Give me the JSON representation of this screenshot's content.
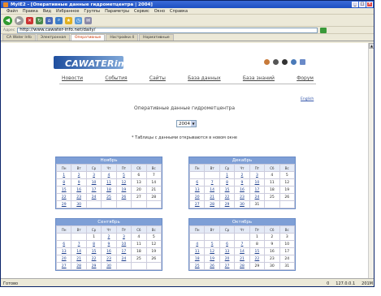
{
  "window": {
    "title": "MyIE2 - [Оперативные данные гидрометцентра | 2004]",
    "buttons": [
      "_",
      "□",
      "×"
    ]
  },
  "menu": [
    "Файл",
    "Правка",
    "Вид",
    "Избранное",
    "Группы",
    "Параметры",
    "Сервис",
    "Окно",
    "Справка"
  ],
  "address": {
    "label": "Адрес",
    "url": "http://www.cawater-info.net/daily/"
  },
  "tabs": [
    "CA Water Info",
    "Электронная",
    "Оперативные",
    "Настройки 4",
    "Нормативные"
  ],
  "site": {
    "logo": "CAWATERinfo",
    "nav": [
      "Новости",
      "События",
      "Сайты",
      "База данных",
      "База знаний",
      "Форум"
    ],
    "lang": "English",
    "heading": "Оперативные данные гидрометцентра",
    "year": "2004",
    "note": "* Таблицы с данными открываются в новом окне"
  },
  "calendars": [
    {
      "month": "Ноябрь",
      "days": [
        "Пн",
        "Вт",
        "Ср",
        "Чт",
        "Пт",
        "Сб",
        "Вс"
      ],
      "weeks": [
        [
          "1",
          "2",
          "3",
          "4",
          "5",
          "6",
          "7"
        ],
        [
          "8",
          "9",
          "10",
          "11",
          "12",
          "13",
          "14"
        ],
        [
          "15",
          "16",
          "17",
          "18",
          "19",
          "20",
          "21"
        ],
        [
          "22",
          "23",
          "24",
          "25",
          "26",
          "27",
          "28"
        ],
        [
          "29",
          "30",
          "",
          "",
          "",
          "",
          ""
        ]
      ],
      "linked": [
        "1",
        "2",
        "3",
        "4",
        "5",
        "8",
        "9",
        "10",
        "11",
        "12",
        "15",
        "16",
        "17",
        "18",
        "19",
        "22",
        "23",
        "24",
        "25",
        "26",
        "29",
        "30"
      ]
    },
    {
      "month": "Декабрь",
      "days": [
        "Пн",
        "Вт",
        "Ср",
        "Чт",
        "Пт",
        "Сб",
        "Вс"
      ],
      "weeks": [
        [
          "",
          "",
          "1",
          "2",
          "3",
          "4",
          "5"
        ],
        [
          "6",
          "7",
          "8",
          "9",
          "10",
          "11",
          "12"
        ],
        [
          "13",
          "14",
          "15",
          "16",
          "17",
          "18",
          "19"
        ],
        [
          "20",
          "21",
          "22",
          "23",
          "24",
          "25",
          "26"
        ],
        [
          "27",
          "28",
          "29",
          "30",
          "31",
          "",
          ""
        ]
      ],
      "linked": [
        "1",
        "2",
        "3",
        "6",
        "7",
        "8",
        "9",
        "10",
        "13",
        "14",
        "15",
        "16",
        "17",
        "20",
        "21",
        "22",
        "23",
        "24",
        "27",
        "28",
        "29",
        "30"
      ]
    },
    {
      "month": "Сентябрь",
      "days": [
        "Пн",
        "Вт",
        "Ср",
        "Чт",
        "Пт",
        "Сб",
        "Вс"
      ],
      "weeks": [
        [
          "",
          "",
          "1",
          "2",
          "3",
          "4",
          "5"
        ],
        [
          "6",
          "7",
          "8",
          "9",
          "10",
          "11",
          "12"
        ],
        [
          "13",
          "14",
          "15",
          "16",
          "17",
          "18",
          "19"
        ],
        [
          "20",
          "21",
          "22",
          "23",
          "24",
          "25",
          "26"
        ],
        [
          "27",
          "28",
          "29",
          "30",
          "",
          "",
          ""
        ]
      ],
      "linked": [
        "2",
        "3",
        "6",
        "7",
        "8",
        "9",
        "10",
        "13",
        "14",
        "15",
        "16",
        "17",
        "20",
        "21",
        "22",
        "23",
        "24",
        "27",
        "28",
        "29",
        "30"
      ]
    },
    {
      "month": "Октябрь",
      "days": [
        "Пн",
        "Вт",
        "Ср",
        "Чт",
        "Пт",
        "Сб",
        "Вс"
      ],
      "weeks": [
        [
          "",
          "",
          "",
          "",
          "1",
          "2",
          "3"
        ],
        [
          "4",
          "5",
          "6",
          "7",
          "8",
          "9",
          "10"
        ],
        [
          "11",
          "12",
          "13",
          "14",
          "15",
          "16",
          "17"
        ],
        [
          "18",
          "19",
          "20",
          "21",
          "22",
          "23",
          "24"
        ],
        [
          "25",
          "26",
          "27",
          "28",
          "29",
          "30",
          "31"
        ]
      ],
      "linked": [
        "4",
        "5",
        "6",
        "7",
        "11",
        "12",
        "13",
        "14",
        "15",
        "18",
        "19",
        "20",
        "21",
        "22",
        "25",
        "26",
        "27",
        "28"
      ]
    }
  ],
  "status": {
    "text": "Готово",
    "count": "0",
    "ip": "127.0.0.1",
    "mem": "201M"
  }
}
